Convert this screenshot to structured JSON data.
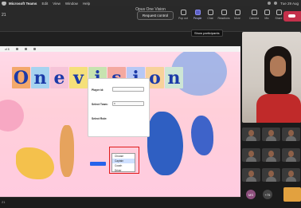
{
  "menubar": {
    "app_name": "Microsoft Teams",
    "items": [
      "Edit",
      "View",
      "Window",
      "Help"
    ],
    "datetime": "Tue 29 Aug"
  },
  "meeting": {
    "window_title": "Opus One Vision",
    "timer": "21",
    "request_control_label": "Request control",
    "tools": [
      {
        "label": "Pop out",
        "icon": "pop-out-icon"
      },
      {
        "label": "People",
        "icon": "people-icon",
        "active": true
      },
      {
        "label": "Chat",
        "icon": "chat-icon"
      },
      {
        "label": "Reactions",
        "icon": "reactions-icon"
      },
      {
        "label": "More",
        "icon": "more-icon"
      },
      {
        "label": "Camera",
        "icon": "camera-icon"
      },
      {
        "label": "Mic",
        "icon": "mic-icon"
      },
      {
        "label": "Share",
        "icon": "share-icon"
      }
    ],
    "tooltip": "Show participants"
  },
  "shared_screen": {
    "zoom_label": "of 8",
    "slide_title_letters": [
      "O",
      "n",
      "e",
      "v",
      "i",
      "s",
      "i",
      "o",
      "n"
    ],
    "letter_colors": [
      "#f3a86b",
      "#a6d3f0",
      "#f6c4d8",
      "#f5e07a",
      "#c7e3b0",
      "#f4a9a0",
      "#b7c8f5",
      "#f7d29a",
      "#cde6d5"
    ],
    "form": {
      "player_label": "Player id:",
      "player_value": "",
      "team_label": "Select Team:",
      "team_value": "8",
      "role_label": "Select Role:",
      "role_options": [
        "Choose",
        "Captain",
        "Coach",
        "Driver"
      ]
    }
  },
  "participants": {
    "self_initials": "MS",
    "overflow_count": "+75"
  }
}
